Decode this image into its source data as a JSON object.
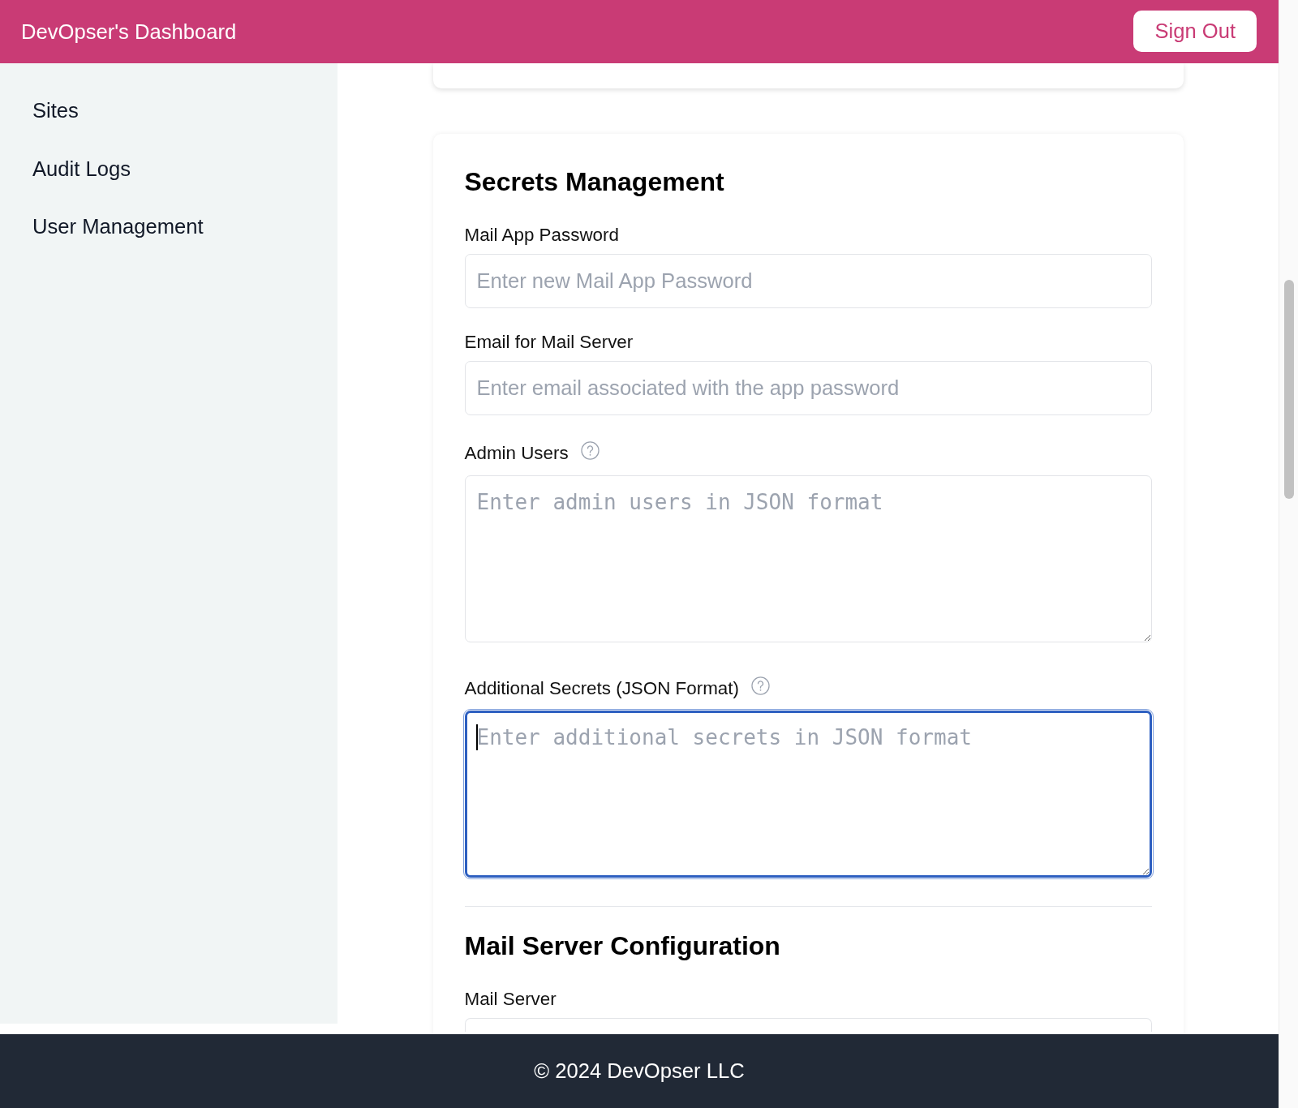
{
  "header": {
    "title": "DevOpser's Dashboard",
    "sign_out_button": "Sign Out"
  },
  "sidebar": {
    "items": [
      {
        "label": "Sites",
        "selected": false
      },
      {
        "label": "Audit Logs",
        "selected": false
      },
      {
        "label": "User Management",
        "selected": false
      }
    ]
  },
  "sections": [
    {
      "title": "Secrets Management",
      "fields": [
        {
          "label": "Mail App Password",
          "kind": "input",
          "placeholder": "Enter new Mail App Password",
          "help_icon": false,
          "focused": false
        },
        {
          "label": "Email for Mail Server",
          "kind": "input",
          "placeholder": "Enter email associated with the app password",
          "help_icon": false,
          "focused": false
        },
        {
          "label": "Admin Users",
          "kind": "textarea",
          "placeholder": "Enter admin users in JSON format",
          "help_icon": true,
          "focused": false
        },
        {
          "label": "Additional Secrets (JSON Format)",
          "kind": "textarea",
          "placeholder": "Enter additional secrets in JSON format",
          "help_icon": true,
          "focused": true
        }
      ]
    },
    {
      "title": "Mail Server Configuration",
      "fields": [
        {
          "label": "Mail Server",
          "kind": "input",
          "help_icon": false,
          "focused": false
        }
      ]
    }
  ],
  "footer": {
    "text": "© 2024 DevOpser LLC"
  }
}
